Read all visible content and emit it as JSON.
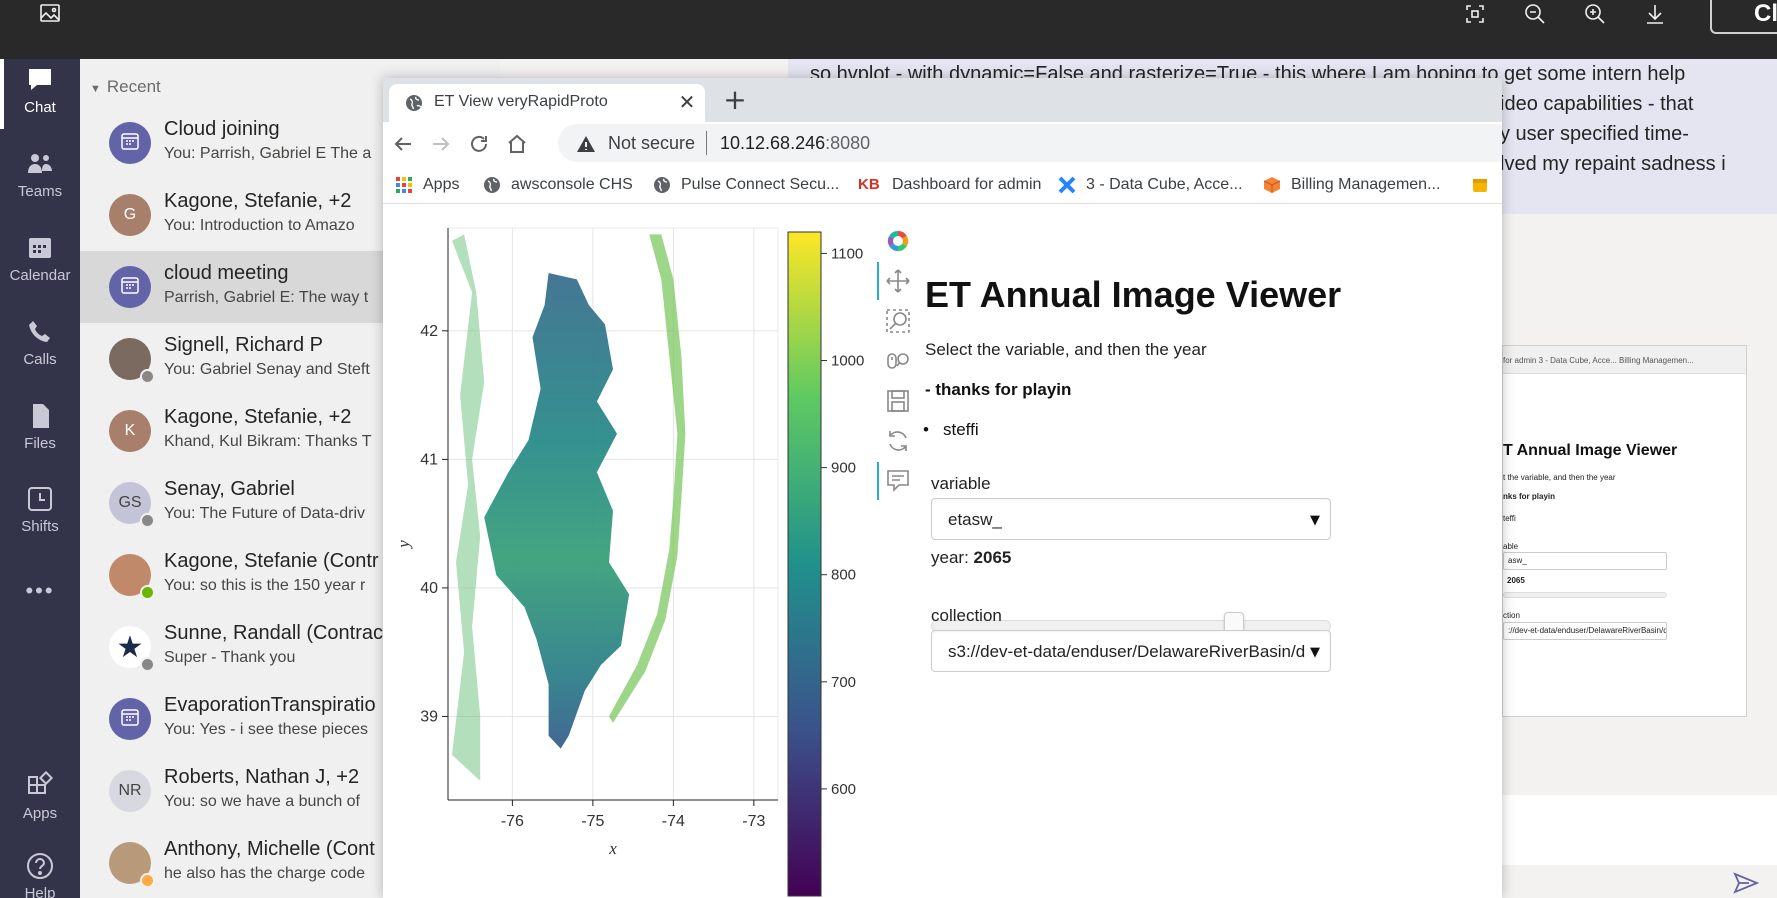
{
  "viewer": {
    "close_label": "Close"
  },
  "rail": {
    "items": [
      {
        "label": "Chat",
        "icon": "chat-icon"
      },
      {
        "label": "Teams",
        "icon": "teams-icon"
      },
      {
        "label": "Calendar",
        "icon": "calendar-icon"
      },
      {
        "label": "Calls",
        "icon": "phone-icon"
      },
      {
        "label": "Files",
        "icon": "file-icon"
      },
      {
        "label": "Shifts",
        "icon": "clock-icon"
      },
      {
        "label": "Apps",
        "icon": "apps-icon"
      },
      {
        "label": "Help",
        "icon": "help-icon"
      }
    ],
    "more": "•••"
  },
  "chatlist": {
    "heading": "Recent",
    "chats": [
      {
        "name": "Cloud joining",
        "preview": "You: Parrish, Gabriel E The a",
        "avatar": "",
        "avatar_color": "#6264a7",
        "status": ""
      },
      {
        "name": "Kagone, Stefanie, +2",
        "preview": "You: Introduction to Amazo",
        "avatar": "G",
        "avatar_color": "#a87f6a",
        "status": ""
      },
      {
        "name": "cloud meeting",
        "preview": "Parrish, Gabriel E: The way t",
        "avatar": "",
        "avatar_color": "#6264a7",
        "status": ""
      },
      {
        "name": "Signell, Richard P",
        "preview": "You: Gabriel Senay and Steft",
        "avatar": "",
        "avatar_color": "#7a6a60",
        "status": "#8a8886"
      },
      {
        "name": "Kagone, Stefanie, +2",
        "preview": "Khand, Kul Bikram: Thanks T",
        "avatar": "K",
        "avatar_color": "#a87f6a",
        "status": ""
      },
      {
        "name": "Senay, Gabriel",
        "preview": "You: The Future of Data-driv",
        "avatar": "GS",
        "avatar_color": "#c4c4d8",
        "status": "#8a8886"
      },
      {
        "name": "Kagone, Stefanie (Contr",
        "preview": "You: so this is the 150 year r",
        "avatar": "",
        "avatar_color": "#c08a6a",
        "status": "#6bb700"
      },
      {
        "name": "Sunne, Randall (Contrac",
        "preview": "Super - Thank you",
        "avatar": "",
        "avatar_color": "#ffffff",
        "status": "#8a8886"
      },
      {
        "name": "EvaporationTranspiratio",
        "preview": "You: Yes - i see these pieces",
        "avatar": "",
        "avatar_color": "#6264a7",
        "status": ""
      },
      {
        "name": "Roberts, Nathan J, +2",
        "preview": "You: so we have a bunch of",
        "avatar": "NR",
        "avatar_color": "#d8d8e0",
        "status": ""
      },
      {
        "name": "Anthony, Michelle (Cont",
        "preview": "he also has the charge code",
        "avatar": "",
        "avatar_color": "#b89a7a",
        "status": "#ffaa44"
      }
    ]
  },
  "conversation": {
    "message": "so hvplot - with dynamic=False and rasterize=True - this where I am hoping to get some intern help",
    "message_lines": [
      "ideo capabilities - that",
      "y user specified time-",
      "lved my repaint sadness i"
    ],
    "thumb": {
      "tabs": "for admin   3 - Data Cube, Acce...   Billing Managemen...",
      "title": "T Annual Image Viewer",
      "sub": "t the variable, and then the year",
      "bold": "nks for playin",
      "bullet": "teffi",
      "label1": "able",
      "val1": "asw_",
      "year": "2065",
      "label3": "ction",
      "val3": "://dev-et-data/enduser/DelawareRiverBasin/d"
    }
  },
  "browser": {
    "tab_title": "ET View veryRapidProto",
    "not_secure": "Not secure",
    "url_host": "10.12.68.246",
    "url_port": ":8080",
    "bookmarks": [
      {
        "label": "Apps",
        "icon": "apps-grid-icon"
      },
      {
        "label": "awsconsole CHS",
        "icon": "globe-icon"
      },
      {
        "label": "Pulse Connect Secu...",
        "icon": "globe-icon"
      },
      {
        "label": "Dashboard for admin",
        "icon": "kb-icon"
      },
      {
        "label": "3 - Data Cube, Acce...",
        "icon": "jira-icon"
      },
      {
        "label": "Billing Managemen...",
        "icon": "aws-box-icon"
      }
    ]
  },
  "app": {
    "title": "ET Annual Image Viewer",
    "subtitle": "Select the variable, and then the year",
    "bold_line": "- thanks for playin",
    "bullet": "steffi",
    "variable_label": "variable",
    "variable_value": "etasw_",
    "year_label": "year: ",
    "year_value": "2065",
    "year_fraction": 0.77,
    "collection_label": "collection",
    "collection_value": "s3://dev-et-data/enduser/DelawareRiverBasin/d"
  },
  "chart_data": {
    "type": "heatmap",
    "title": "",
    "xlabel": "x",
    "ylabel": "y",
    "xlim": [
      -76.8,
      -72.7
    ],
    "ylim": [
      38.35,
      42.8
    ],
    "xticks": [
      -76,
      -75,
      -74,
      -73
    ],
    "yticks": [
      39,
      40,
      41,
      42
    ],
    "grid": true,
    "colorbar": {
      "ticks": [
        600,
        700,
        800,
        900,
        1000,
        1100
      ],
      "range": [
        500,
        1120
      ],
      "colormap": "viridis"
    }
  }
}
